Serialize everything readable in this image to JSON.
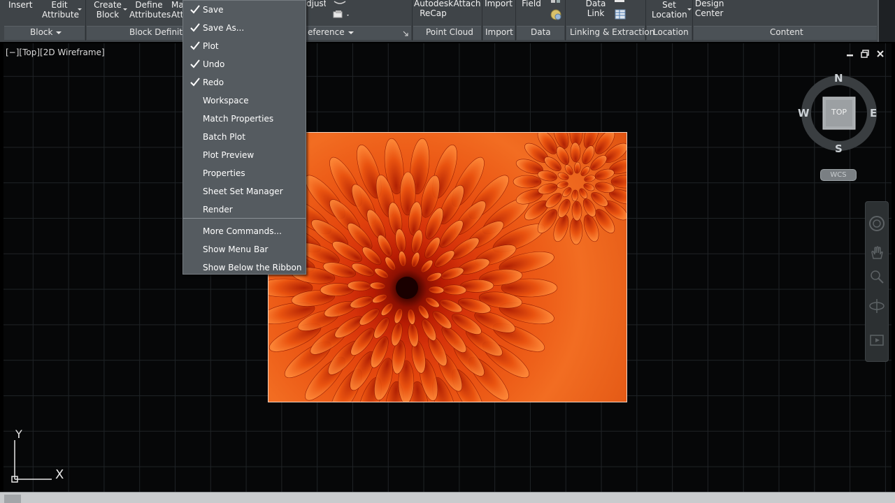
{
  "ribbon": {
    "buttons": {
      "insert": "Insert",
      "edit_attribute": [
        "Edit",
        "Attribute"
      ],
      "create_block": [
        "Create",
        "Block"
      ],
      "define_attributes": [
        "Define",
        "Attributes"
      ],
      "manage_attributes": [
        "Ma",
        "Att"
      ],
      "adjust": "djust",
      "autodesk_recap": [
        "Autodesk",
        "ReCap"
      ],
      "attach": "Attach",
      "import": "Import",
      "field": "Field",
      "data_link": [
        "Data",
        "Link"
      ],
      "set_location": [
        "Set",
        "Location"
      ],
      "design_center": [
        "Design",
        "Center"
      ]
    },
    "panels": {
      "block": "Block",
      "block_definition": "Block Definiti",
      "reference": "eference",
      "point_cloud": "Point Cloud",
      "import": "Import",
      "data": "Data",
      "linking_extraction": "Linking & Extraction",
      "location": "Location",
      "content": "Content"
    }
  },
  "viewport": {
    "label": "[−][Top][2D Wireframe]"
  },
  "viewcube": {
    "north": "N",
    "south": "S",
    "east": "E",
    "west": "W",
    "face": "TOP",
    "ucs_menu": "WCS"
  },
  "ucs_icon": {
    "x_label": "X",
    "y_label": "Y"
  },
  "qat_menu": {
    "items": [
      {
        "label": "Save",
        "checked": true
      },
      {
        "label": "Save As...",
        "checked": true
      },
      {
        "label": "Plot",
        "checked": true
      },
      {
        "label": "Undo",
        "checked": true
      },
      {
        "label": "Redo",
        "checked": true
      },
      {
        "label": "Workspace",
        "checked": false
      },
      {
        "label": "Match Properties",
        "checked": false
      },
      {
        "label": "Batch Plot",
        "checked": false
      },
      {
        "label": "Plot Preview",
        "checked": false
      },
      {
        "label": "Properties",
        "checked": false
      },
      {
        "label": "Sheet Set Manager",
        "checked": false
      },
      {
        "label": "Render",
        "checked": false
      },
      {
        "label": "More Commands...",
        "checked": false
      },
      {
        "label": "Show Menu Bar",
        "checked": false
      },
      {
        "label": "Show Below the Ribbon",
        "checked": false
      }
    ]
  },
  "colors": {
    "ribbon_bg": "#3f4448",
    "panel_bar": "#4b5156",
    "viewport_bg": "#060708",
    "grid": "#1f2326",
    "menu_bg": "#555b60",
    "flower_orange": "#ec5a16"
  }
}
